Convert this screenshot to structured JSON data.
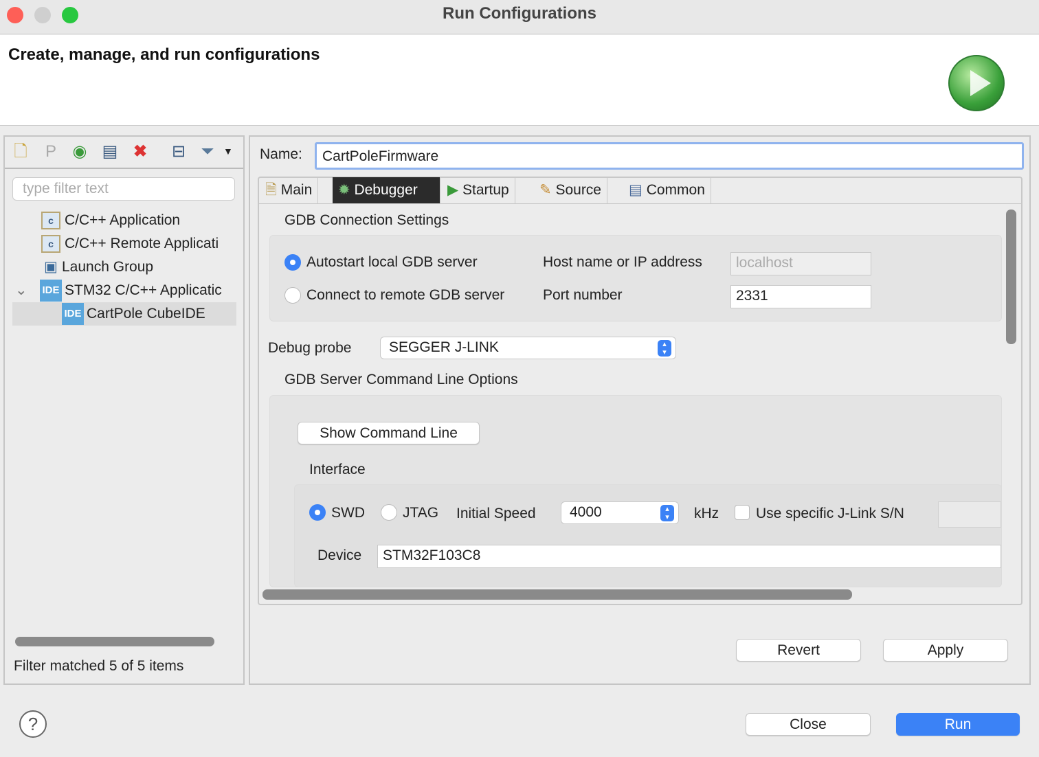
{
  "window": {
    "title": "Run Configurations",
    "header": "Create, manage, and run configurations"
  },
  "sidebar": {
    "filter_placeholder": "type filter text",
    "items": [
      {
        "label": "C/C++ Application",
        "icon": "c-app-icon"
      },
      {
        "label": "C/C++ Remote Applicati",
        "icon": "c-app-icon"
      },
      {
        "label": "Launch Group",
        "icon": "launch-group-icon"
      },
      {
        "label": "STM32 C/C++ Applicatic",
        "icon": "ide-icon"
      },
      {
        "label": "CartPole CubeIDE",
        "icon": "ide-icon",
        "selected": true
      }
    ],
    "status": "Filter matched 5 of 5 items"
  },
  "main": {
    "name_label": "Name:",
    "name_value": "CartPoleFirmware",
    "tabs": [
      {
        "label": "Main"
      },
      {
        "label": "Debugger",
        "active": true
      },
      {
        "label": "Startup"
      },
      {
        "label": "Source"
      },
      {
        "label": "Common"
      }
    ],
    "gdb_title": "GDB Connection Settings",
    "autostart": "Autostart local GDB server",
    "connect_remote": "Connect to remote GDB server",
    "host_label": "Host name or IP address",
    "host_value": "localhost",
    "port_label": "Port number",
    "port_value": "2331",
    "probe_label": "Debug probe",
    "probe_value": "SEGGER J-LINK",
    "server_title": "GDB Server Command Line Options",
    "show_cmd": "Show Command Line",
    "interface_label": "Interface",
    "swd": "SWD",
    "jtag": "JTAG",
    "speed_label": "Initial Speed",
    "speed_value": "4000",
    "khz": "kHz",
    "use_sn": "Use specific J-Link S/N",
    "device_label": "Device",
    "device_value": "STM32F103C8",
    "revert": "Revert",
    "apply": "Apply"
  },
  "footer": {
    "close": "Close",
    "run": "Run",
    "help": "?"
  },
  "colors": {
    "accent": "#3b82f6"
  }
}
